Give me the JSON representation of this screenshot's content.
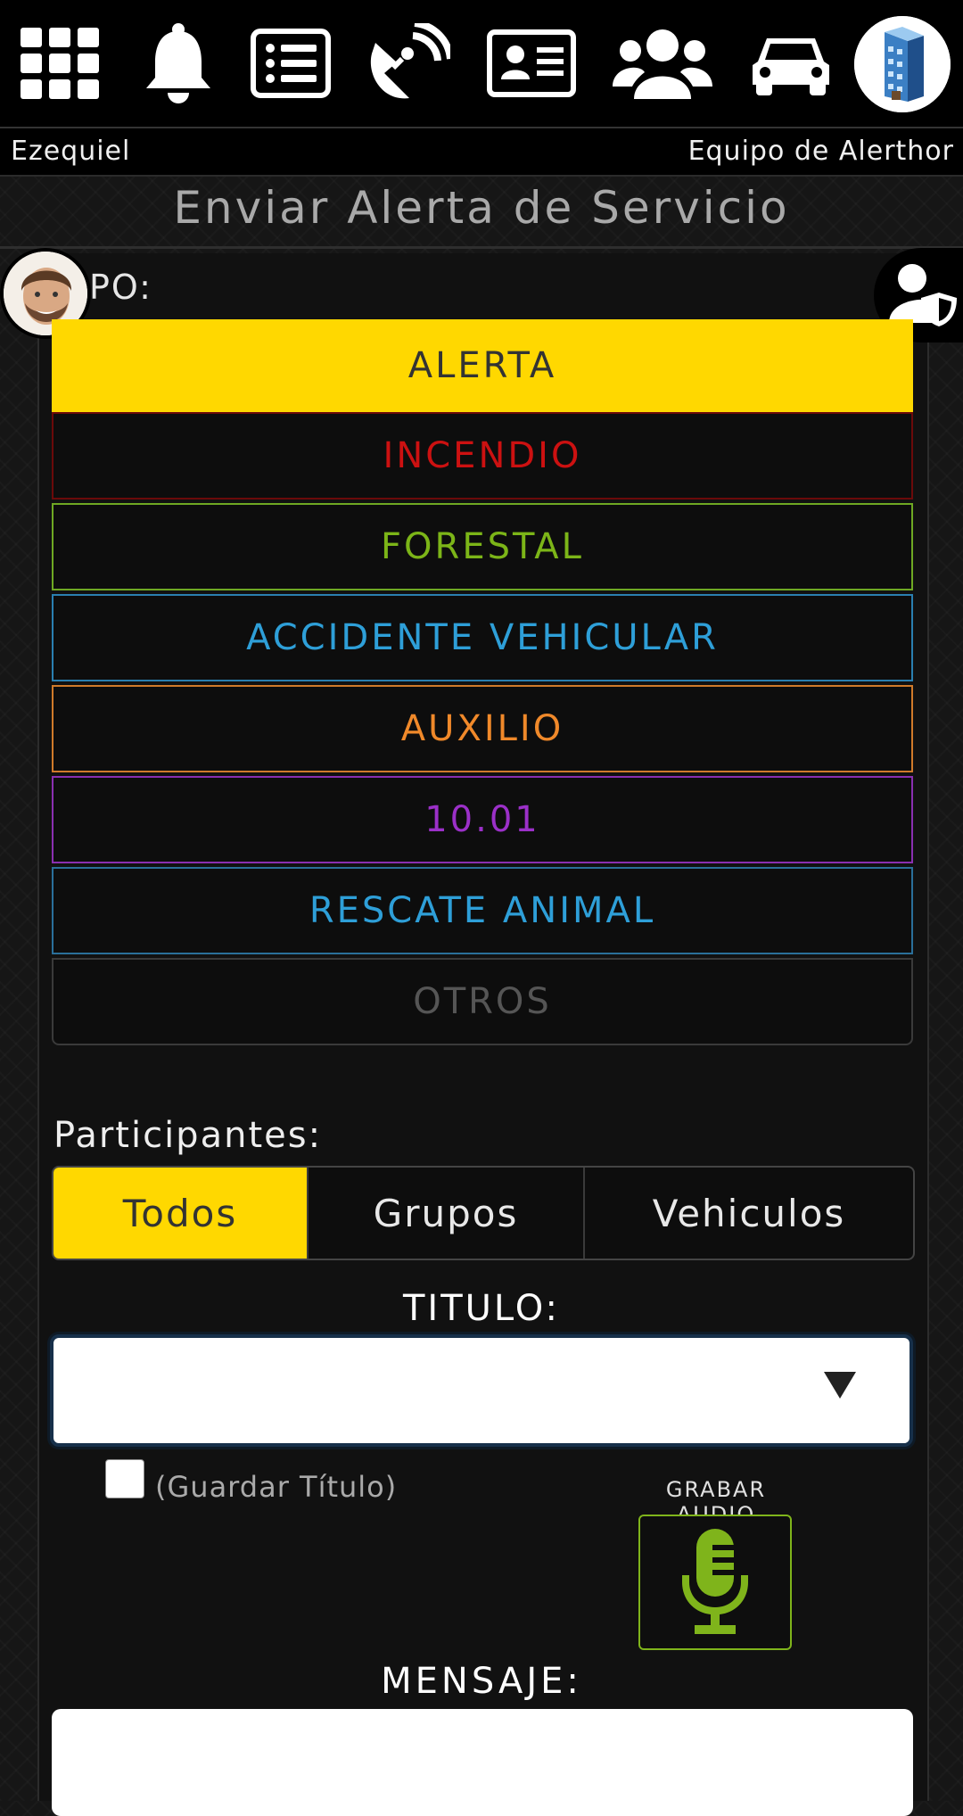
{
  "topbar": {
    "icons": [
      "grid-icon",
      "bell-icon",
      "list-icon",
      "satellite-dish-icon",
      "id-card-icon",
      "users-icon",
      "car-icon",
      "building-icon"
    ]
  },
  "user": {
    "name": "Ezequiel",
    "team": "Equipo de Alerthor"
  },
  "page": {
    "title": "Enviar Alerta de Servicio"
  },
  "tipo": {
    "label": "PO:"
  },
  "alert_types": [
    {
      "label": "ALERTA",
      "color": "#ffd800",
      "selected": true
    },
    {
      "label": "INCENDIO",
      "color": "#cc1111"
    },
    {
      "label": "FORESTAL",
      "color": "#7cb518"
    },
    {
      "label": "ACCIDENTE VEHICULAR",
      "color": "#2e9fd8"
    },
    {
      "label": "AUXILIO",
      "color": "#f0892a"
    },
    {
      "label": "10.01",
      "color": "#9b30c8"
    },
    {
      "label": "RESCATE ANIMAL",
      "color": "#2e9fd8"
    },
    {
      "label": "OTROS",
      "color": "#555555"
    }
  ],
  "participants": {
    "label": "Participantes:",
    "options": [
      "Todos",
      "Grupos",
      "Vehiculos"
    ],
    "selected": "Todos"
  },
  "titulo": {
    "label": "TITULO:",
    "value": "",
    "save_label": "(Guardar Título)"
  },
  "audio": {
    "label": "GRABAR AUDIO",
    "accent": "#7fb41b"
  },
  "mensaje": {
    "label": "MENSAJE:",
    "value": ""
  }
}
